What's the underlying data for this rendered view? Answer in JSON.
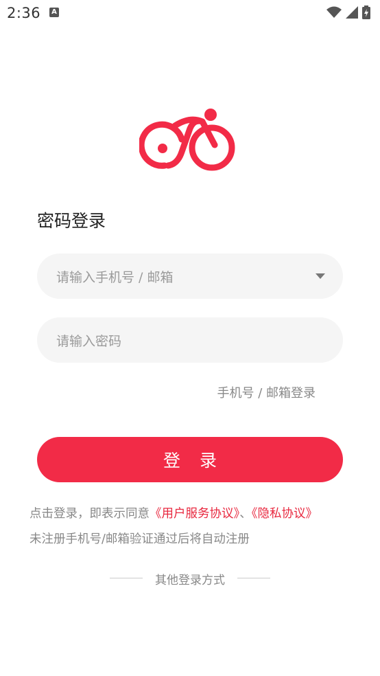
{
  "status_bar": {
    "time": "2:36",
    "app_icon": "A",
    "icons": [
      "wifi-icon",
      "signal-icon",
      "battery-icon"
    ]
  },
  "logo": {
    "icon": "bicycle-logo-icon",
    "color": "#f22b47"
  },
  "title": "密码登录",
  "account_field": {
    "placeholder": "请输入手机号 / 邮箱",
    "icon": "dropdown-arrow-icon"
  },
  "password_field": {
    "placeholder": "请输入密码"
  },
  "switch_login_link": "手机号 / 邮箱登录",
  "login_button": "登 录",
  "agreement": {
    "prefix": "点击登录，即表示同意",
    "user_agreement": "《用户服务协议》",
    "separator": "、",
    "privacy_agreement": "《隐私协议》",
    "note": "未注册手机号/邮箱验证通过后将自动注册"
  },
  "other_login_label": "其他登录方式",
  "colors": {
    "accent": "#f22b47",
    "field_bg": "#f5f5f5",
    "muted_text": "#888888"
  }
}
